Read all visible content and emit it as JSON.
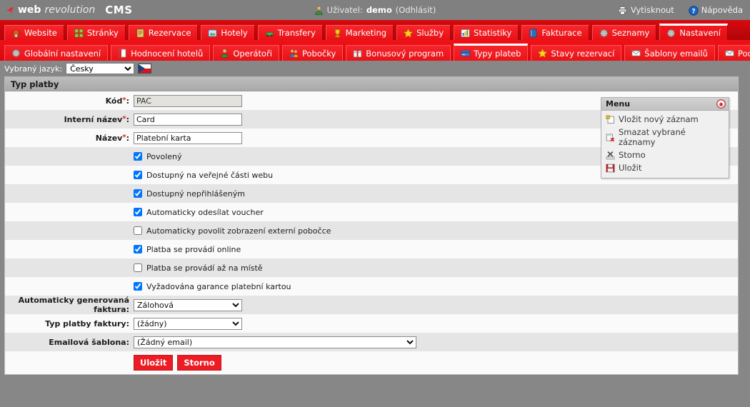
{
  "brand": {
    "web": "web",
    "revolution": " revolution",
    "cms": "CMS"
  },
  "topbar": {
    "user_prefix": "Uživatel:",
    "user_name": "demo",
    "logout": "(Odhlásit)",
    "print": "Vytisknout",
    "help": "Nápověda"
  },
  "nav1": [
    {
      "label": "Website",
      "icon": "house-icon",
      "active": false
    },
    {
      "label": "Stránky",
      "icon": "pages-icon",
      "active": false
    },
    {
      "label": "Rezervace",
      "icon": "booking-icon",
      "active": false
    },
    {
      "label": "Hotely",
      "icon": "hotel-icon",
      "active": false
    },
    {
      "label": "Transfery",
      "icon": "car-icon",
      "active": false
    },
    {
      "label": "Marketing",
      "icon": "trophy-icon",
      "active": false
    },
    {
      "label": "Služby",
      "icon": "star-icon",
      "active": false
    },
    {
      "label": "Statistiky",
      "icon": "chart-icon",
      "active": false
    },
    {
      "label": "Fakturace",
      "icon": "book-icon",
      "active": false
    },
    {
      "label": "Seznamy",
      "icon": "gear-icon",
      "active": false
    },
    {
      "label": "Nastavení",
      "icon": "gear-icon",
      "active": true
    }
  ],
  "nav2": [
    {
      "label": "Globální nastavení",
      "icon": "gear-icon",
      "active": false
    },
    {
      "label": "Hodnocení hotelů",
      "icon": "book-red-icon",
      "active": false
    },
    {
      "label": "Operátoři",
      "icon": "user-icon",
      "active": false
    },
    {
      "label": "Pobočky",
      "icon": "users-icon",
      "active": false
    },
    {
      "label": "Bonusový program",
      "icon": "gift-icon",
      "active": false
    },
    {
      "label": "Typy plateb",
      "icon": "card-icon",
      "active": true
    },
    {
      "label": "Stavy rezervací",
      "icon": "star-icon",
      "active": false
    },
    {
      "label": "Šablony emailů",
      "icon": "mail-icon",
      "active": false
    },
    {
      "label": "Podpisy emailů",
      "icon": "mail-icon",
      "active": false
    }
  ],
  "language": {
    "label": "Vybraný jazyk:",
    "selected": "Česky",
    "options": [
      "Česky"
    ],
    "flag": "cz-flag-icon"
  },
  "panel": {
    "title": "Typ platby"
  },
  "form": {
    "code": {
      "label": "Kód",
      "required": true,
      "value": "PAC",
      "disabled": true
    },
    "internal_name": {
      "label": "Interní název",
      "required": true,
      "value": "Card",
      "disabled": false
    },
    "name": {
      "label": "Název",
      "required": true,
      "value": "Platební karta",
      "disabled": false
    },
    "checkboxes": [
      {
        "label": "Povolený",
        "checked": true
      },
      {
        "label": "Dostupný na veřejné části webu",
        "checked": true
      },
      {
        "label": "Dostupný nepřihlášeným",
        "checked": true
      },
      {
        "label": "Automaticky odesílat voucher",
        "checked": true
      },
      {
        "label": "Automaticky povolit zobrazení externí pobočce",
        "checked": false
      },
      {
        "label": "Platba se provádí online",
        "checked": true
      },
      {
        "label": "Platba se provádí až na místě",
        "checked": false
      },
      {
        "label": "Vyžadována garance platební kartou",
        "checked": true
      }
    ],
    "auto_invoice": {
      "label": "Automaticky generovaná faktura:",
      "selected": "Zálohová",
      "options": [
        "Zálohová"
      ]
    },
    "invoice_payment_type": {
      "label": "Typ platby faktury:",
      "selected": "(žádny)",
      "options": [
        "(žádny)"
      ]
    },
    "email_template": {
      "label": "Emailová šablona:",
      "selected": "(Žádný email)",
      "options": [
        "(Žádný email)"
      ]
    },
    "save_button": "Uložit",
    "cancel_button": "Storno"
  },
  "menu": {
    "title": "Menu",
    "collapse_icon": "collapse-up-icon",
    "items": [
      {
        "label": "Vložit nový záznam",
        "icon": "new-record-icon"
      },
      {
        "label": "Smazat vybrané záznamy",
        "icon": "delete-records-icon"
      },
      {
        "label": "Storno",
        "icon": "cancel-icon"
      },
      {
        "label": "Uložit",
        "icon": "save-disk-icon"
      }
    ]
  },
  "colors": {
    "brand_red": "#ed1c24",
    "nav_dark_red": "#c9070d",
    "topbar_grey": "#808080",
    "page_grey": "#878787",
    "row_odd": "#fafafa",
    "row_even": "#e5e5e5"
  }
}
